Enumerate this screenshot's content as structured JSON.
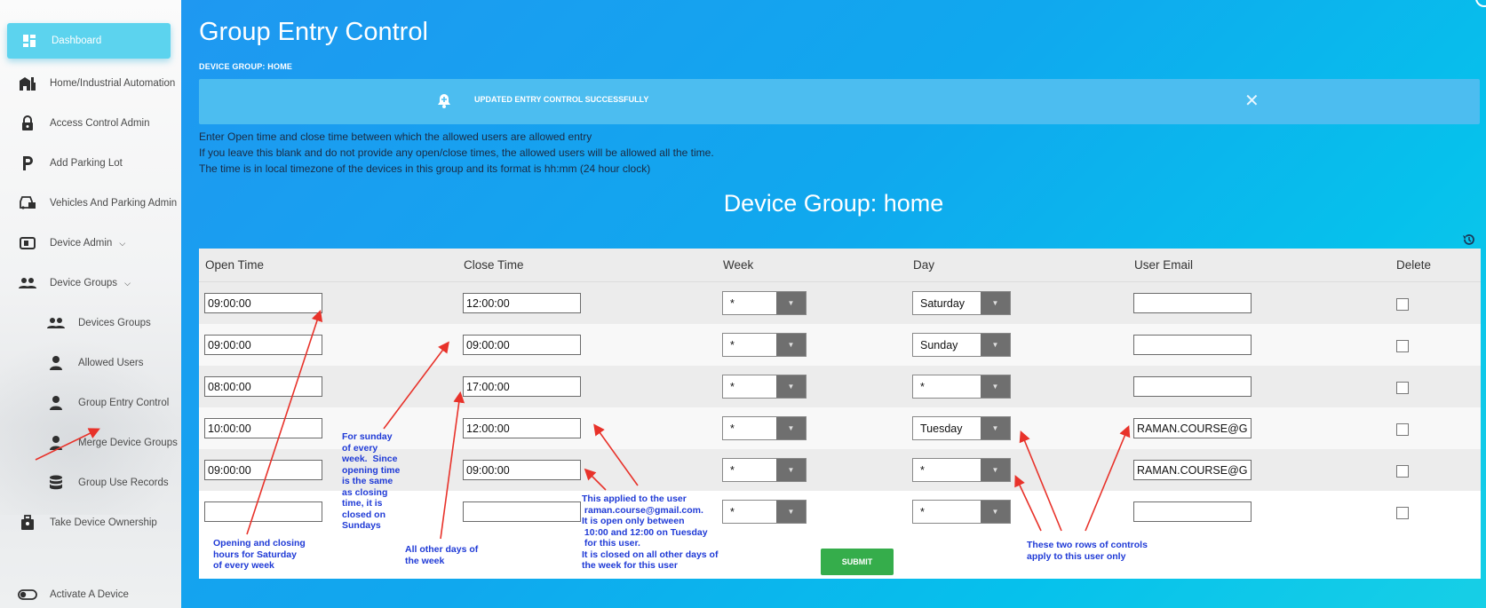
{
  "sidebar": {
    "items": [
      {
        "label": "Dashboard",
        "icon": "dashboard-icon"
      },
      {
        "label": "Home/Industrial Automation",
        "icon": "factory-icon"
      },
      {
        "label": "Access Control Admin",
        "icon": "lock-icon"
      },
      {
        "label": "Add Parking Lot",
        "icon": "parking-icon"
      },
      {
        "label": "Vehicles And Parking Admin",
        "icon": "vehicle-icon"
      },
      {
        "label": "Device Admin",
        "icon": "device-icon"
      },
      {
        "label": "Device Groups",
        "icon": "people-icon"
      },
      {
        "label": "Devices Groups",
        "icon": "people-icon"
      },
      {
        "label": "Allowed Users",
        "icon": "person-icon"
      },
      {
        "label": "Group Entry Control",
        "icon": "person-icon"
      },
      {
        "label": "Merge Device Groups",
        "icon": "person-icon"
      },
      {
        "label": "Group Use Records",
        "icon": "database-icon"
      },
      {
        "label": "Take Device Ownership",
        "icon": "ownership-icon"
      },
      {
        "label": "Activate A Device",
        "icon": "toggle-icon"
      }
    ]
  },
  "header": {
    "title": "Group Entry Control",
    "breadcrumb": "DEVICE GROUP: HOME"
  },
  "alert": {
    "message": "UPDATED ENTRY CONTROL SUCCESSFULLY",
    "close": "✕"
  },
  "info": {
    "line1": "Enter Open time and close time between which the allowed users are allowed entry",
    "line2": "If you leave this blank and do not provide any open/close times, the allowed users will be allowed all the time.",
    "line3": "The time is in local timezone of the devices in this group and its format is hh:mm (24 hour clock)"
  },
  "group_title": "Device Group: home",
  "table": {
    "headers": {
      "open": "Open Time",
      "close": "Close Time",
      "week": "Week",
      "day": "Day",
      "email": "User Email",
      "delete": "Delete"
    },
    "rows": [
      {
        "open": "09:00:00",
        "close": "12:00:00",
        "week": "*",
        "day": "Saturday",
        "email": "",
        "delete": false
      },
      {
        "open": "09:00:00",
        "close": "09:00:00",
        "week": "*",
        "day": "Sunday",
        "email": "",
        "delete": false
      },
      {
        "open": "08:00:00",
        "close": "17:00:00",
        "week": "*",
        "day": "*",
        "email": "",
        "delete": false
      },
      {
        "open": "10:00:00",
        "close": "12:00:00",
        "week": "*",
        "day": "Tuesday",
        "email": "RAMAN.COURSE@GM",
        "delete": false
      },
      {
        "open": "09:00:00",
        "close": "09:00:00",
        "week": "*",
        "day": "*",
        "email": "RAMAN.COURSE@GM",
        "delete": false
      },
      {
        "open": "",
        "close": "",
        "week": "*",
        "day": "*",
        "email": "",
        "delete": false
      }
    ],
    "submit": "SUBMIT"
  },
  "annotations": {
    "saturday": "Opening and closing\nhours for Saturday\nof every week",
    "sunday": "For sunday\nof every\nweek.  Since\nopening time\nis the same\nas closing\ntime, it is\nclosed on\nSundays",
    "other_days": "All other days of\nthe week",
    "user": "This applied to the user\n raman.course@gmail.com.\nIt is open only between\n 10:00 and 12:00 on Tuesday\n for this user.\nIt is closed on all other days of\nthe week for this user",
    "two_rows": "These two rows of controls\napply to this user only"
  },
  "colors": {
    "accent": "#5cd3ee",
    "main_bg_start": "#1f98f1",
    "main_bg_end": "#17cfe6",
    "alert_bg": "#4cbdf0",
    "submit_bg": "#35ad4b",
    "annotation_text": "#1f3ad6",
    "annotation_arrow": "#e8322a"
  }
}
